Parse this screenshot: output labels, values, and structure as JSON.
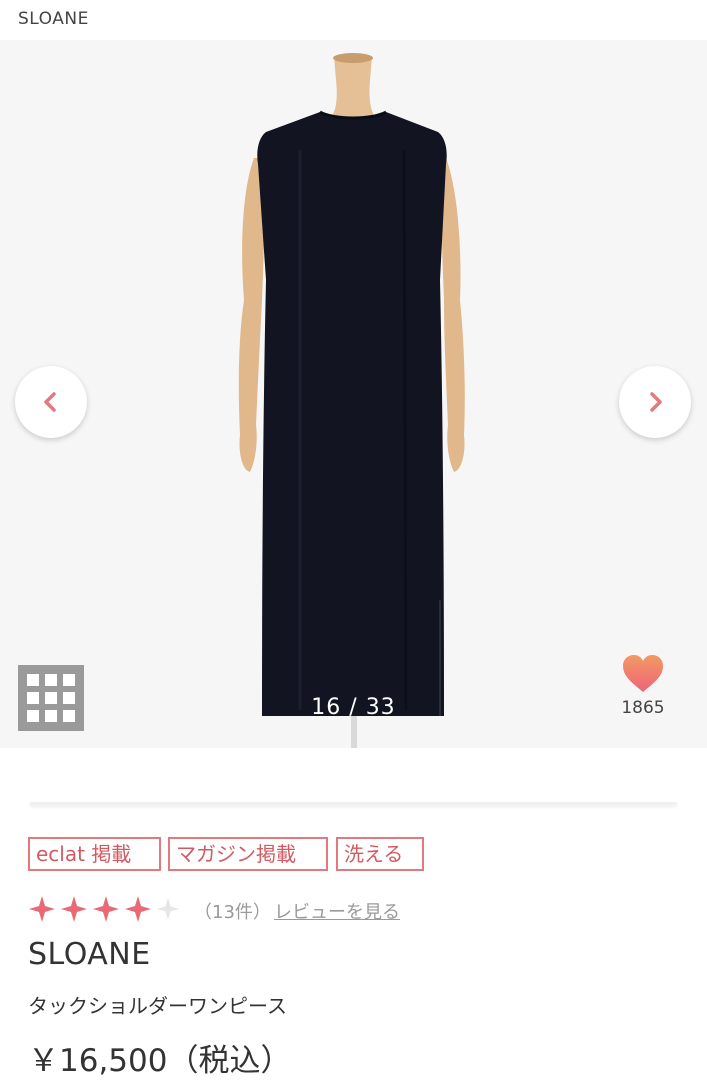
{
  "header": {
    "brand": "SLOANE"
  },
  "gallery": {
    "current": "16",
    "separator": "/",
    "total": "33",
    "counter_text": "16 / 33",
    "prev_icon": "chevron-left-icon",
    "next_icon": "chevron-right-icon",
    "grid_icon": "grid-icon",
    "favorite_icon": "heart-icon",
    "favorite_count": "1865"
  },
  "product": {
    "tags": [
      "eclat 掲載",
      "マガジン掲載",
      "洗える"
    ],
    "rating": {
      "value": 4,
      "max": 5
    },
    "review_count": "（13件）",
    "review_link": "レビューを見る",
    "brand": "SLOANE",
    "name": "タックショルダーワンピース",
    "price": "￥16,500（税込）"
  },
  "colors": {
    "accent": "#e07a7f",
    "star": "#e86a76",
    "star_empty": "#e6e6e6",
    "heart_top": "#f08a6a",
    "heart_bottom": "#ef6c77",
    "text": "#333333"
  }
}
